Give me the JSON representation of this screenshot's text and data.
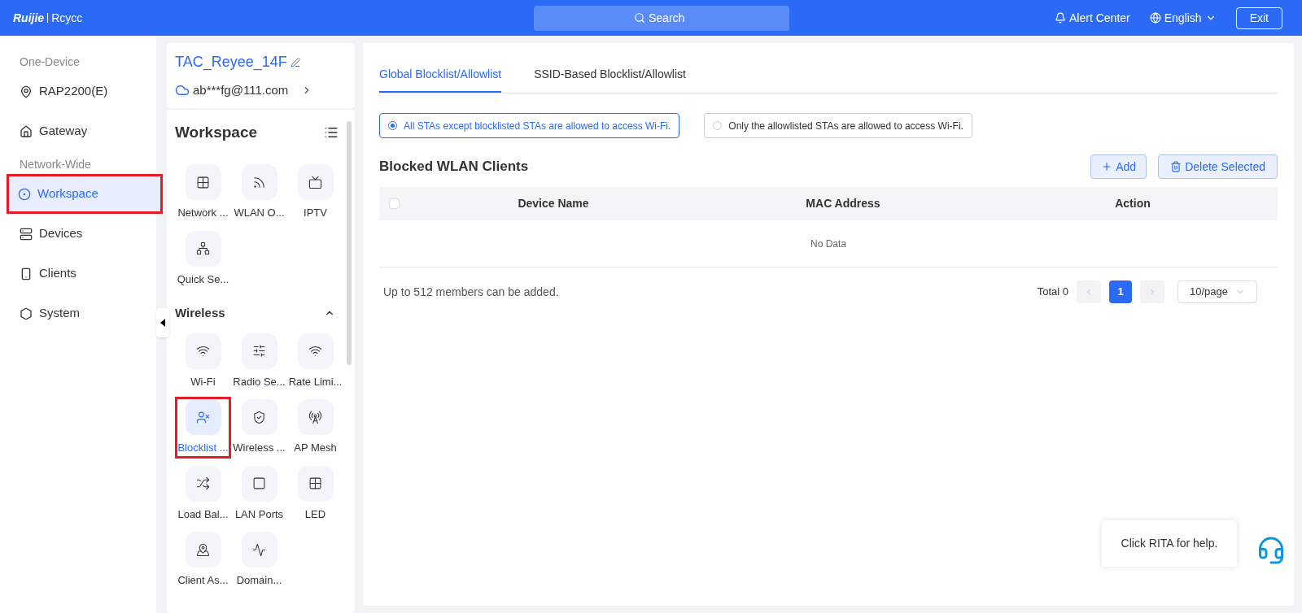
{
  "header": {
    "logo": "Ruijie",
    "brand": "Rcycc",
    "search": {
      "placeholder": "Search"
    },
    "alert_center": "Alert Center",
    "language": "English",
    "exit": "Exit"
  },
  "sidebar": {
    "sections": [
      {
        "title": "One-Device",
        "items": [
          {
            "label": "RAP2200(E)",
            "selected": false
          },
          {
            "label": "Gateway",
            "selected": false
          }
        ]
      },
      {
        "title": "Network-Wide",
        "items": [
          {
            "label": "Workspace",
            "selected": true
          },
          {
            "label": "Devices",
            "selected": false
          },
          {
            "label": "Clients",
            "selected": false
          },
          {
            "label": "System",
            "selected": false
          }
        ]
      }
    ]
  },
  "project": {
    "name": "TAC_Reyee_14F",
    "account": "ab***fg@111.com"
  },
  "workspace": {
    "title": "Workspace",
    "groups": [
      {
        "tiles": [
          {
            "label": "Network ...",
            "selected": false
          },
          {
            "label": "WLAN O...",
            "selected": false
          },
          {
            "label": "IPTV",
            "selected": false
          },
          {
            "label": "Quick Se...",
            "selected": false
          }
        ]
      },
      {
        "title": "Wireless",
        "expanded": true,
        "tiles": [
          {
            "label": "Wi-Fi",
            "selected": false
          },
          {
            "label": "Radio Se...",
            "selected": false
          },
          {
            "label": "Rate Limi...",
            "selected": false
          },
          {
            "label": "Blocklist ...",
            "selected": true
          },
          {
            "label": "Wireless ...",
            "selected": false
          },
          {
            "label": "AP Mesh",
            "selected": false
          },
          {
            "label": "Load Bal...",
            "selected": false
          },
          {
            "label": "LAN Ports",
            "selected": false
          },
          {
            "label": "LED",
            "selected": false
          },
          {
            "label": "Client As...",
            "selected": false
          },
          {
            "label": "Domain...",
            "selected": false
          }
        ]
      }
    ]
  },
  "tabs": [
    {
      "label": "Global Blocklist/Allowlist",
      "selected": true
    },
    {
      "label": "SSID-Based Blocklist/Allowlist",
      "selected": false
    }
  ],
  "modes": [
    {
      "label": "All STAs except blocklisted STAs are allowed to access Wi-Fi.",
      "selected": true
    },
    {
      "label": "Only the allowlisted STAs are allowed to access Wi-Fi.",
      "selected": false
    }
  ],
  "list": {
    "title": "Blocked WLAN Clients",
    "add": "Add",
    "delete": "Delete Selected",
    "columns": [
      "Device Name",
      "MAC Address",
      "Action"
    ],
    "empty": "No Data",
    "note": "Up to 512 members can be added.",
    "total": "Total 0",
    "pages": [
      {
        "label": "1",
        "selected": true
      }
    ],
    "page_size": "10/page"
  },
  "select_all": {
    "checked": false
  },
  "help": {
    "text": "Click RITA for help."
  }
}
